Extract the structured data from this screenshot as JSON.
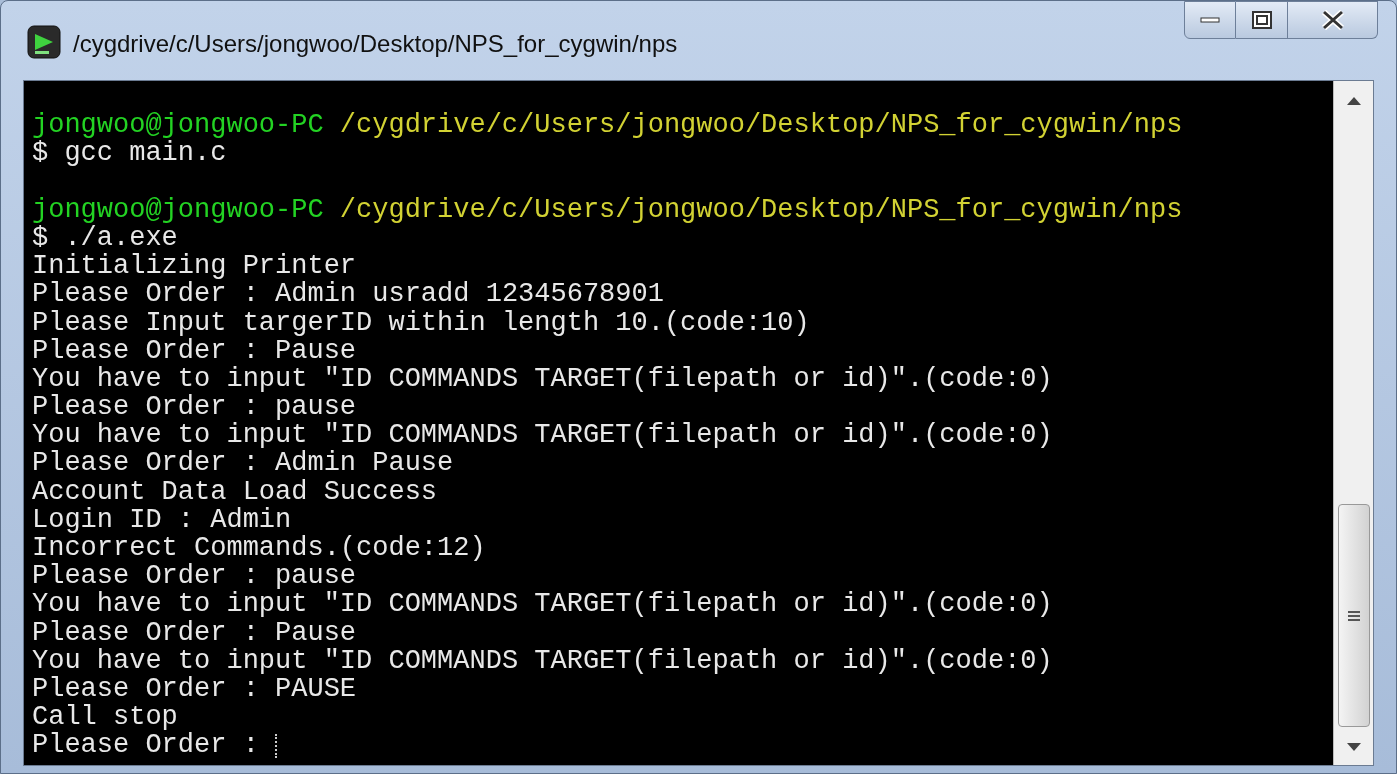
{
  "window": {
    "title": "/cygdrive/c/Users/jongwoo/Desktop/NPS_for_cygwin/nps"
  },
  "terminal": {
    "lines": [
      {
        "kind": "blank"
      },
      {
        "kind": "prompt",
        "user": "jongwoo@jongwoo-PC",
        "path": "/cygdrive/c/Users/jongwoo/Desktop/NPS_for_cygwin/nps"
      },
      {
        "kind": "text",
        "text": "$ gcc main.c"
      },
      {
        "kind": "blank"
      },
      {
        "kind": "prompt",
        "user": "jongwoo@jongwoo-PC",
        "path": "/cygdrive/c/Users/jongwoo/Desktop/NPS_for_cygwin/nps"
      },
      {
        "kind": "text",
        "text": "$ ./a.exe"
      },
      {
        "kind": "text",
        "text": "Initializing Printer"
      },
      {
        "kind": "text",
        "text": "Please Order : Admin usradd 12345678901"
      },
      {
        "kind": "text",
        "text": "Please Input targerID within length 10.(code:10)"
      },
      {
        "kind": "text",
        "text": "Please Order : Pause"
      },
      {
        "kind": "text",
        "text": "You have to input \"ID COMMANDS TARGET(filepath or id)\".(code:0)"
      },
      {
        "kind": "text",
        "text": "Please Order : pause"
      },
      {
        "kind": "text",
        "text": "You have to input \"ID COMMANDS TARGET(filepath or id)\".(code:0)"
      },
      {
        "kind": "text",
        "text": "Please Order : Admin Pause"
      },
      {
        "kind": "text",
        "text": "Account Data Load Success"
      },
      {
        "kind": "text",
        "text": "Login ID : Admin"
      },
      {
        "kind": "text",
        "text": "Incorrect Commands.(code:12)"
      },
      {
        "kind": "text",
        "text": "Please Order : pause"
      },
      {
        "kind": "text",
        "text": "You have to input \"ID COMMANDS TARGET(filepath or id)\".(code:0)"
      },
      {
        "kind": "text",
        "text": "Please Order : Pause"
      },
      {
        "kind": "text",
        "text": "You have to input \"ID COMMANDS TARGET(filepath or id)\".(code:0)"
      },
      {
        "kind": "text",
        "text": "Please Order : PAUSE"
      },
      {
        "kind": "text",
        "text": "Call stop"
      },
      {
        "kind": "input",
        "text": "Please Order :"
      }
    ]
  }
}
